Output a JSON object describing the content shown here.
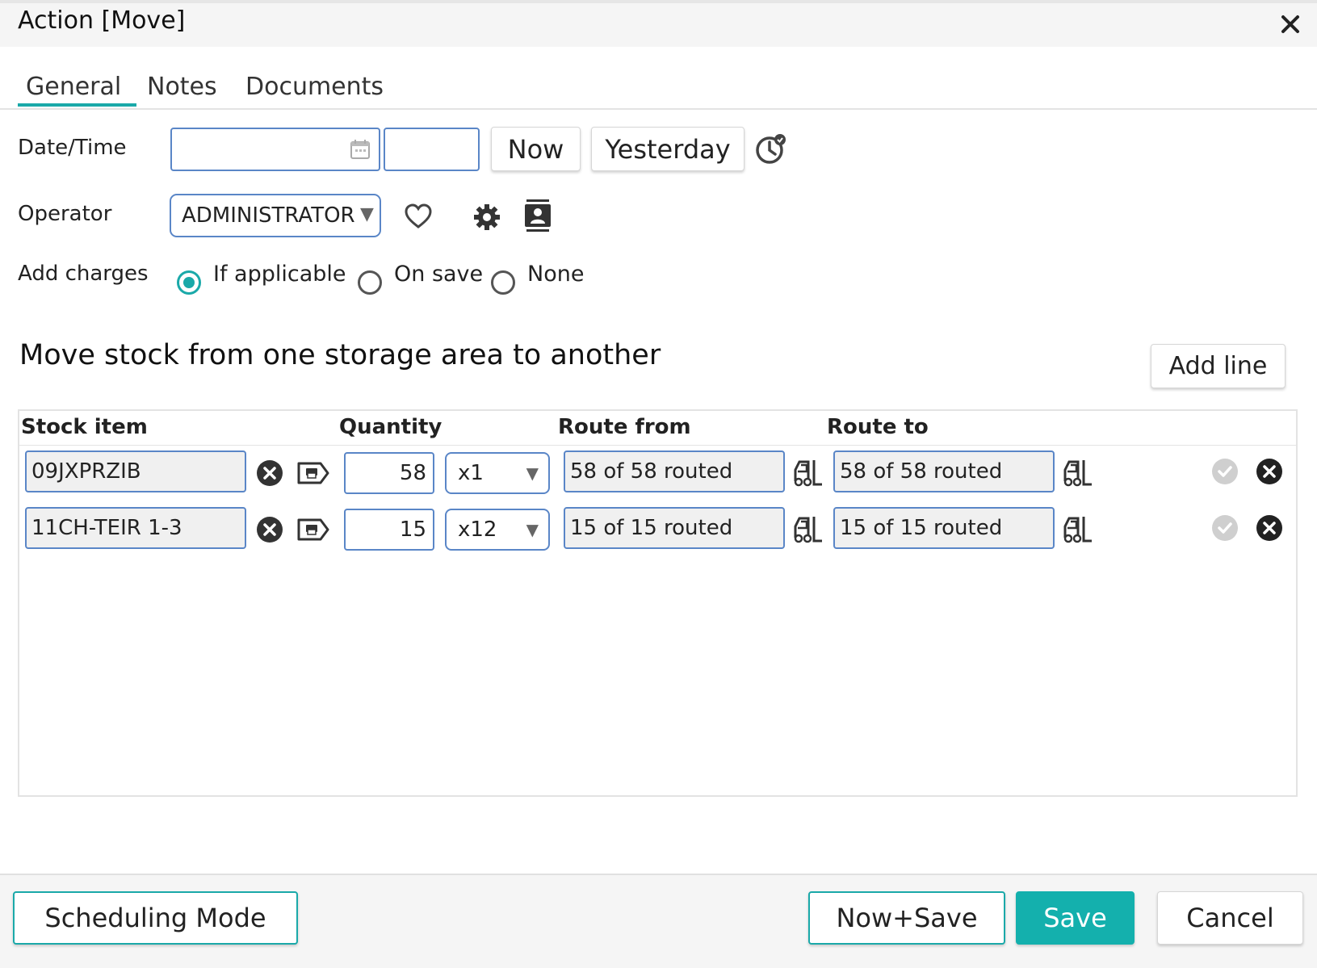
{
  "window": {
    "title": "Action [Move]"
  },
  "tabs": [
    {
      "label": "General",
      "active": true
    },
    {
      "label": "Notes",
      "active": false
    },
    {
      "label": "Documents",
      "active": false
    }
  ],
  "form": {
    "datetime": {
      "label": "Date/Time",
      "date_value": "",
      "time_value": "",
      "now_label": "Now",
      "yesterday_label": "Yesterday"
    },
    "operator": {
      "label": "Operator",
      "value": "ADMINISTRATOR"
    },
    "add_charges": {
      "label": "Add charges",
      "options": [
        "If applicable",
        "On save",
        "None"
      ],
      "selected": "If applicable"
    }
  },
  "section": {
    "title": "Move stock from one storage area to another",
    "add_line_label": "Add line"
  },
  "grid": {
    "columns": [
      "Stock item",
      "Quantity",
      "Route from",
      "Route to"
    ],
    "rows": [
      {
        "stock_item": "09JXPRZIB",
        "quantity": "58",
        "unit": "x1",
        "route_from": "58 of 58 routed",
        "route_to": "58 of 58 routed"
      },
      {
        "stock_item": "11CH-TEIR 1-3",
        "quantity": "15",
        "unit": "x12",
        "route_from": "15 of 15 routed",
        "route_to": "15 of 15 routed"
      }
    ]
  },
  "footer": {
    "scheduling_label": "Scheduling Mode",
    "now_save_label": "Now+Save",
    "save_label": "Save",
    "cancel_label": "Cancel"
  },
  "colors": {
    "accent": "#1aa9a9",
    "input_border": "#5a86c7",
    "save_bg": "#14b0ad"
  },
  "icons": [
    "close-icon",
    "calendar-icon",
    "clock-icon",
    "heart-icon",
    "gear-icon",
    "contact-card-icon",
    "clear-icon",
    "tag-icon",
    "forklift-icon",
    "check-icon",
    "remove-icon",
    "chevron-down-icon"
  ]
}
